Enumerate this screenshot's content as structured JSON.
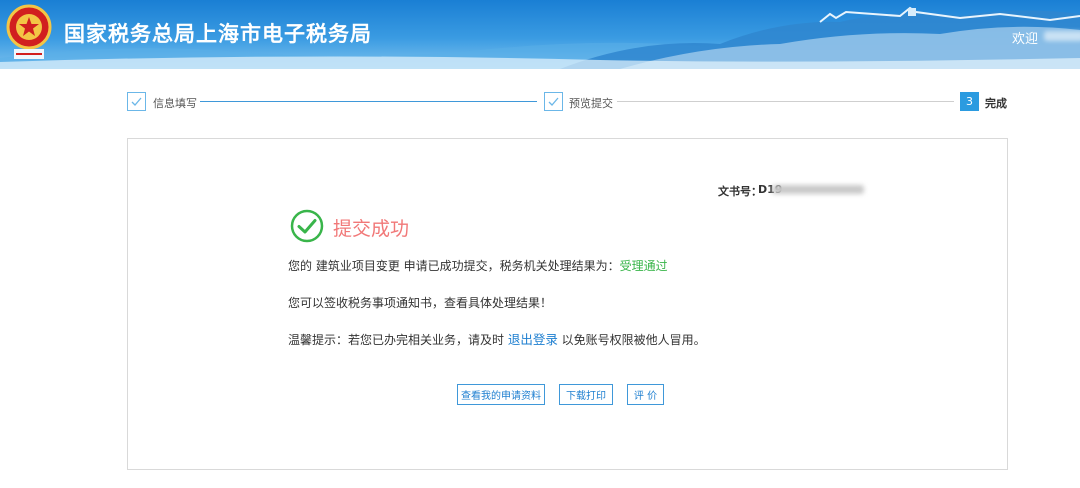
{
  "header": {
    "title": "国家税务总局上海市电子税务局",
    "welcome": "欢迎",
    "emblem_icon": "tax-emblem-icon"
  },
  "steps": [
    {
      "label": "信息填写",
      "state": "done"
    },
    {
      "label": "预览提交",
      "state": "done"
    },
    {
      "label": "完成",
      "state": "active",
      "number": "3"
    }
  ],
  "result": {
    "doc_no_label": "文书号：",
    "doc_no_prefix": "D19",
    "success_title": "提交成功",
    "line1_prefix": "您的 建筑业项目变更 申请已成功提交，税务机关处理结果为：",
    "line1_status": "受理通过",
    "line2": "您可以签收税务事项通知书，查看具体处理结果！",
    "line3_prefix": "温馨提示：若您已办完相关业务，请及时 ",
    "line3_link": "退出登录",
    "line3_suffix": " 以免账号权限被他人冒用。"
  },
  "buttons": {
    "view_materials": "查看我的申请资料",
    "download_print": "下载打印",
    "evaluate": "评 价"
  },
  "colors": {
    "header_blue": "#1a7fd4",
    "accent_blue": "#2b9be0",
    "success_green": "#39b54a",
    "title_red": "#f17878"
  }
}
